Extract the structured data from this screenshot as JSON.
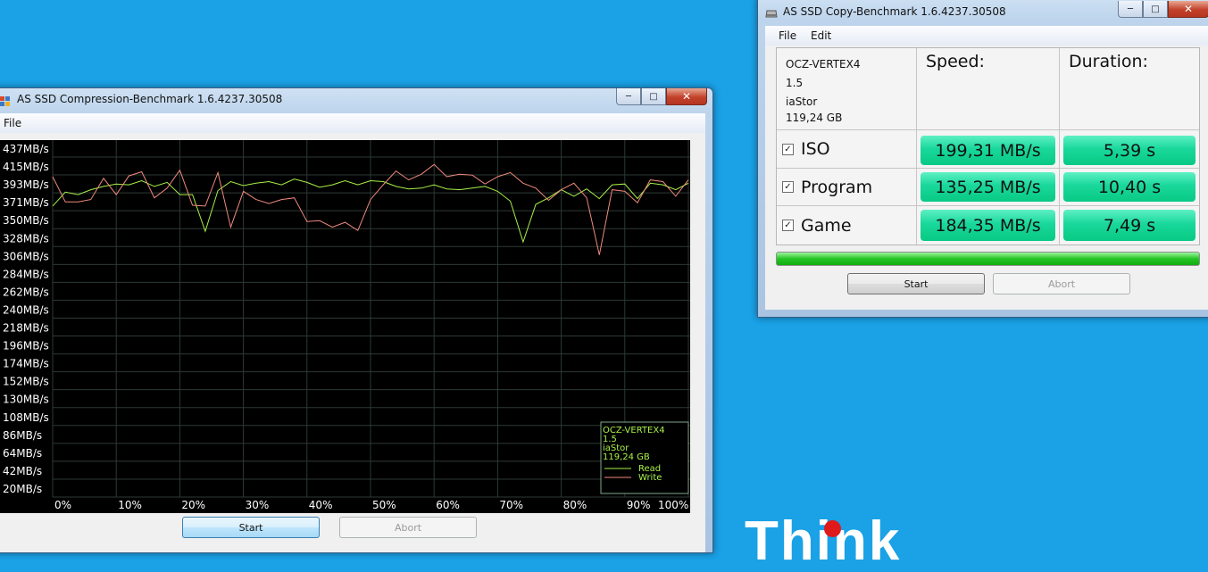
{
  "compression_window": {
    "title": "AS SSD Compression-Benchmark 1.6.4237.30508",
    "menu": [
      "File"
    ],
    "buttons": {
      "start": "Start",
      "abort": "Abort"
    },
    "legend": {
      "device": "OCZ-VERTEX4",
      "firmware": "1.5",
      "driver": "iaStor",
      "size": "119,24 GB",
      "read_label": "Read",
      "write_label": "Write",
      "read_color": "#a8f048",
      "write_color": "#f08a7e"
    }
  },
  "chart_data": {
    "type": "line",
    "y_ticks": [
      "437MB/s",
      "415MB/s",
      "393MB/s",
      "371MB/s",
      "350MB/s",
      "328MB/s",
      "306MB/s",
      "284MB/s",
      "262MB/s",
      "240MB/s",
      "218MB/s",
      "196MB/s",
      "174MB/s",
      "152MB/s",
      "130MB/s",
      "108MB/s",
      "86MB/s",
      "64MB/s",
      "42MB/s",
      "20MB/s"
    ],
    "x_ticks": [
      "0%",
      "10%",
      "20%",
      "30%",
      "40%",
      "50%",
      "60%",
      "70%",
      "80%",
      "90%",
      "100%"
    ],
    "ylim": [
      20,
      437
    ],
    "xlim": [
      0,
      100
    ],
    "grid": true,
    "legend_position": "bottom-right",
    "series": [
      {
        "name": "Read",
        "color": "#a8f048",
        "x": [
          0,
          2,
          4,
          6,
          8,
          10,
          12,
          14,
          16,
          18,
          20,
          22,
          24,
          26,
          28,
          30,
          32,
          34,
          36,
          38,
          40,
          42,
          44,
          46,
          48,
          50,
          52,
          54,
          56,
          58,
          60,
          62,
          64,
          66,
          68,
          70,
          72,
          74,
          76,
          78,
          80,
          82,
          84,
          86,
          88,
          90,
          92,
          94,
          96,
          98,
          100
        ],
        "y": [
          366,
          383,
          380,
          386,
          390,
          393,
          392,
          397,
          390,
          395,
          380,
          380,
          335,
          385,
          396,
          391,
          394,
          396,
          392,
          399,
          395,
          389,
          392,
          397,
          392,
          397,
          396,
          390,
          387,
          388,
          392,
          387,
          386,
          388,
          390,
          384,
          372,
          322,
          368,
          376,
          386,
          378,
          387,
          375,
          392,
          393,
          375,
          394,
          392,
          386,
          394
        ]
      },
      {
        "name": "Write",
        "color": "#f08a7e",
        "x": [
          0,
          2,
          4,
          6,
          8,
          10,
          12,
          14,
          16,
          18,
          20,
          22,
          24,
          26,
          28,
          30,
          32,
          34,
          36,
          38,
          40,
          42,
          44,
          46,
          48,
          50,
          52,
          54,
          56,
          58,
          60,
          62,
          64,
          66,
          68,
          70,
          72,
          74,
          76,
          78,
          80,
          82,
          84,
          86,
          88,
          90,
          92,
          94,
          96,
          98,
          100
        ],
        "y": [
          402,
          371,
          371,
          374,
          400,
          380,
          403,
          408,
          376,
          388,
          410,
          367,
          366,
          407,
          340,
          384,
          374,
          369,
          374,
          376,
          347,
          348,
          340,
          346,
          336,
          374,
          392,
          409,
          398,
          405,
          417,
          402,
          405,
          404,
          393,
          402,
          407,
          394,
          388,
          373,
          386,
          394,
          376,
          306,
          386,
          384,
          370,
          398,
          396,
          378,
          398
        ]
      }
    ]
  },
  "copy_window": {
    "title": "AS SSD Copy-Benchmark 1.6.4237.30508",
    "menu": [
      "File",
      "Edit"
    ],
    "device": {
      "name": "OCZ-VERTEX4",
      "firmware": "1.5",
      "driver": "iaStor",
      "size": "119,24 GB"
    },
    "headers": {
      "speed": "Speed:",
      "duration": "Duration:"
    },
    "rows": [
      {
        "label": "ISO",
        "checked": true,
        "speed": "199,31 MB/s",
        "duration": "5,39 s"
      },
      {
        "label": "Program",
        "checked": true,
        "speed": "135,25 MB/s",
        "duration": "10,40 s"
      },
      {
        "label": "Game",
        "checked": true,
        "speed": "184,35 MB/s",
        "duration": "7,49 s"
      }
    ],
    "progress": 1.0,
    "buttons": {
      "start": "Start",
      "abort": "Abort"
    }
  },
  "wallpaper": {
    "brand_text": "Think"
  }
}
